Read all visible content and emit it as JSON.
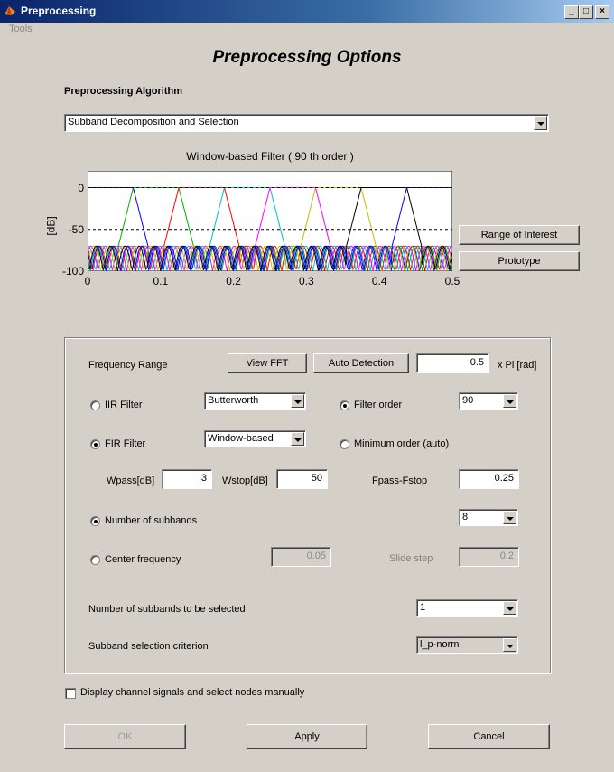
{
  "window": {
    "title": "Preprocessing"
  },
  "menu": {
    "tools": "Tools"
  },
  "header": {
    "title": "Preprocessing Options",
    "algorithm_label": "Preprocessing Algorithm"
  },
  "algorithm": {
    "selected": "Subband Decomposition and Selection"
  },
  "plot": {
    "title": "Window-based Filter  ( 90 th order )",
    "ylabel": "[dB]",
    "xticks": [
      "0",
      "0.1",
      "0.2",
      "0.3",
      "0.4",
      "0.5"
    ],
    "yticks": [
      "0",
      "-50",
      "-100"
    ]
  },
  "chart_data": {
    "type": "line",
    "title": "Window-based Filter  ( 90 th order )",
    "xlabel": "",
    "ylabel": "[dB]",
    "xlim": [
      0,
      0.5
    ],
    "ylim": [
      -100,
      20
    ],
    "reference_lines": [
      0,
      -50
    ],
    "series": [
      {
        "color": "#0000ff",
        "band": [
          0.0,
          0.0625
        ]
      },
      {
        "color": "#00aa00",
        "band": [
          0.0625,
          0.125
        ]
      },
      {
        "color": "#ff0000",
        "band": [
          0.125,
          0.1875
        ]
      },
      {
        "color": "#00bfbf",
        "band": [
          0.1875,
          0.25
        ]
      },
      {
        "color": "#ff00ff",
        "band": [
          0.25,
          0.3125
        ]
      },
      {
        "color": "#bfbf00",
        "band": [
          0.3125,
          0.375
        ]
      },
      {
        "color": "#000000",
        "band": [
          0.375,
          0.4375
        ]
      },
      {
        "color": "#0000ff",
        "band": [
          0.4375,
          0.5
        ]
      }
    ]
  },
  "side_buttons": {
    "range": "Range of Interest",
    "prototype": "Prototype"
  },
  "freq": {
    "label": "Frequency Range",
    "view_fft": "View FFT",
    "auto_detect": "Auto Detection",
    "value": "0.5",
    "unit": "x Pi [rad]"
  },
  "filter": {
    "iir_label": "IIR Filter",
    "iir_type": "Butterworth",
    "fir_label": "FIR Filter",
    "fir_type": "Window-based",
    "order_label": "Filter order",
    "order_value": "90",
    "min_order_label": "Minimum order (auto)",
    "wpass_label": "Wpass[dB]",
    "wpass_value": "3",
    "wstop_label": "Wstop[dB]",
    "wstop_value": "50",
    "fpass_label": "Fpass-Fstop",
    "fpass_value": "0.25"
  },
  "subbands": {
    "num_label": "Number of subbands",
    "num_value": "8",
    "center_label": "Center frequency",
    "center_value": "0.05",
    "slide_label": "Slide step",
    "slide_value": "0.2",
    "select_label": "Number of subbands to be selected",
    "select_value": "1",
    "criterion_label": "Subband selection criterion",
    "criterion_value": "l_p-norm"
  },
  "manual": {
    "label": "Display channel signals and select nodes manually"
  },
  "footer": {
    "ok": "OK",
    "apply": "Apply",
    "cancel": "Cancel"
  }
}
